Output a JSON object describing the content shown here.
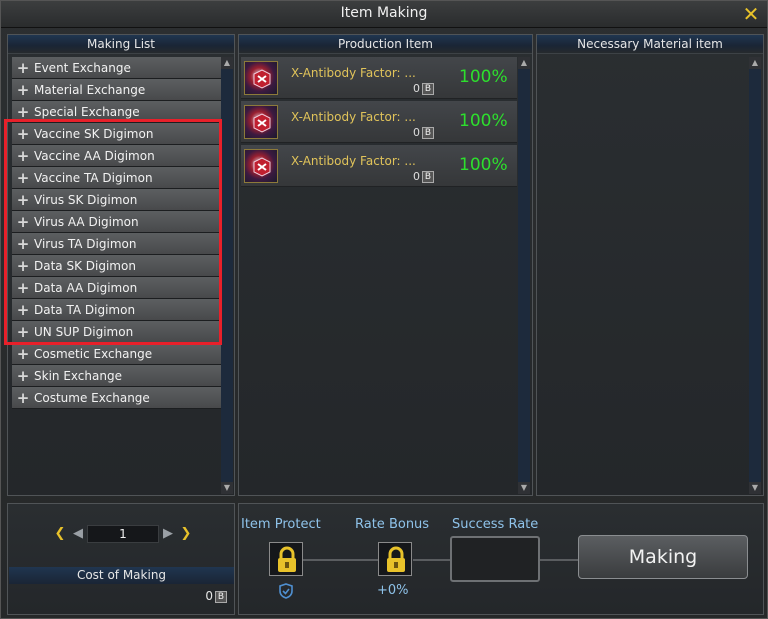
{
  "window": {
    "title": "Item Making"
  },
  "making_list": {
    "header": "Making List",
    "items": [
      {
        "label": "Event Exchange"
      },
      {
        "label": "Material Exchange"
      },
      {
        "label": "Special Exchange"
      },
      {
        "label": "Vaccine SK Digimon"
      },
      {
        "label": "Vaccine AA Digimon"
      },
      {
        "label": "Vaccine TA Digimon"
      },
      {
        "label": "Virus SK Digimon"
      },
      {
        "label": "Virus AA Digimon"
      },
      {
        "label": "Virus TA Digimon"
      },
      {
        "label": "Data SK Digimon"
      },
      {
        "label": "Data AA Digimon"
      },
      {
        "label": "Data TA Digimon"
      },
      {
        "label": "UN SUP Digimon"
      },
      {
        "label": "Cosmetic Exchange"
      },
      {
        "label": "Skin Exchange"
      },
      {
        "label": "Costume Exchange"
      }
    ]
  },
  "production": {
    "header": "Production Item",
    "items": [
      {
        "name": "X-Antibody Factor: ...",
        "count": "0",
        "currency": "B",
        "rate": "100%"
      },
      {
        "name": "X-Antibody Factor: ...",
        "count": "0",
        "currency": "B",
        "rate": "100%"
      },
      {
        "name": "X-Antibody Factor: ...",
        "count": "0",
        "currency": "B",
        "rate": "100%"
      }
    ]
  },
  "materials": {
    "header": "Necessary Material item"
  },
  "quantity": {
    "value": "1"
  },
  "cost": {
    "label": "Cost of Making",
    "value": "0",
    "currency": "B"
  },
  "bottom": {
    "item_protect": "Item Protect",
    "rate_bonus": "Rate Bonus",
    "rate_bonus_value": "+0%",
    "success_rate": "Success Rate",
    "making_label": "Making"
  },
  "colors": {
    "accent_gold": "#e8c22a",
    "rate_green": "#2ddf2d",
    "label_blue": "#8fc3ea",
    "highlight_red": "#e8202a"
  },
  "icons": {
    "close": "close-icon",
    "plus": "plus-icon",
    "lock": "lock-icon",
    "shield": "shield-icon",
    "item": "antibody-item-icon"
  }
}
